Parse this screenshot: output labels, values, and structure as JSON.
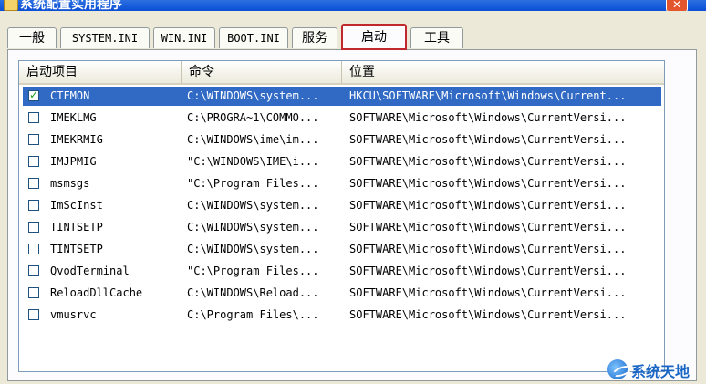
{
  "window": {
    "title": "系统配置实用程序",
    "close_label": "✕"
  },
  "tabs": [
    {
      "label": "一般"
    },
    {
      "label": "SYSTEM.INI"
    },
    {
      "label": "WIN.INI"
    },
    {
      "label": "BOOT.INI"
    },
    {
      "label": "服务"
    },
    {
      "label": "启动",
      "active": true
    },
    {
      "label": "工具"
    }
  ],
  "list": {
    "columns": [
      "启动项目",
      "命令",
      "位置"
    ],
    "rows": [
      {
        "item": "CTFMON",
        "command": "C:\\WINDOWS\\system...",
        "location": "HKCU\\SOFTWARE\\Microsoft\\Windows\\Current...",
        "checked": true,
        "selected": true
      },
      {
        "item": "IMEKLMG",
        "command": "C:\\PROGRA~1\\COMMO...",
        "location": "SOFTWARE\\Microsoft\\Windows\\CurrentVersi...",
        "checked": false
      },
      {
        "item": "IMEKRMIG",
        "command": "C:\\WINDOWS\\ime\\im...",
        "location": "SOFTWARE\\Microsoft\\Windows\\CurrentVersi...",
        "checked": false
      },
      {
        "item": "IMJPMIG",
        "command": "\"C:\\WINDOWS\\IME\\i...",
        "location": "SOFTWARE\\Microsoft\\Windows\\CurrentVersi...",
        "checked": false
      },
      {
        "item": "msmsgs",
        "command": "\"C:\\Program Files...",
        "location": "SOFTWARE\\Microsoft\\Windows\\CurrentVersi...",
        "checked": false
      },
      {
        "item": "ImScInst",
        "command": "C:\\WINDOWS\\system...",
        "location": "SOFTWARE\\Microsoft\\Windows\\CurrentVersi...",
        "checked": false
      },
      {
        "item": "TINTSETP",
        "command": "C:\\WINDOWS\\system...",
        "location": "SOFTWARE\\Microsoft\\Windows\\CurrentVersi...",
        "checked": false
      },
      {
        "item": "TINTSETP",
        "command": "C:\\WINDOWS\\system...",
        "location": "SOFTWARE\\Microsoft\\Windows\\CurrentVersi...",
        "checked": false
      },
      {
        "item": "QvodTerminal",
        "command": "\"C:\\Program Files...",
        "location": "SOFTWARE\\Microsoft\\Windows\\CurrentVersi...",
        "checked": false
      },
      {
        "item": "ReloadDllCache",
        "command": "C:\\WINDOWS\\Reload...",
        "location": "SOFTWARE\\Microsoft\\Windows\\CurrentVersi...",
        "checked": false
      },
      {
        "item": "vmusrvc",
        "command": "C:\\Program Files\\...",
        "location": "SOFTWARE\\Microsoft\\Windows\\CurrentVersi...",
        "checked": false
      }
    ]
  },
  "watermark": {
    "text": "系统天地"
  },
  "colors": {
    "selection": "#316ac5",
    "active_tab_highlight": "#c0282d",
    "checkmark": "#21a121"
  }
}
